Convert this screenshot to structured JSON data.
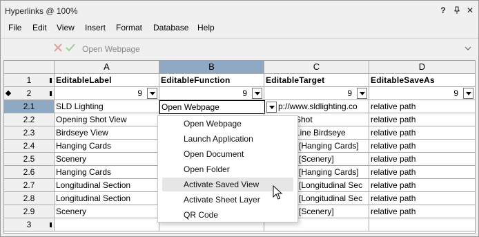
{
  "window": {
    "title": "Hyperlinks @ 100%"
  },
  "titlebar_buttons": [
    "?",
    "▾",
    "✕"
  ],
  "menu": [
    "File",
    "Edit",
    "View",
    "Insert",
    "Format",
    "Database",
    "Help"
  ],
  "command_bar": {
    "value": "Open Webpage"
  },
  "grid": {
    "columns": [
      "A",
      "B",
      "C",
      "D"
    ],
    "header_row": {
      "label": "1",
      "fields": [
        "EditableLabel",
        "EditableFunction",
        "EditableTarget",
        "EditableSaveAs"
      ]
    },
    "width_row": {
      "label": "2",
      "values": [
        "9",
        "9",
        "9",
        "9"
      ]
    },
    "rows": [
      {
        "label": "2.1",
        "cells": [
          "SLD Lighting",
          "Open Webpage",
          "p://www.sldlighting.co",
          "relative path"
        ]
      },
      {
        "label": "2.2",
        "cells": [
          "Opening Shot View",
          "",
          "Shot",
          "relative path"
        ]
      },
      {
        "label": "2.3",
        "cells": [
          "Birdseye View",
          "",
          "Line Birdseye",
          "relative path"
        ]
      },
      {
        "label": "2.4",
        "cells": [
          "Hanging Cards",
          "",
          "[Hanging Cards]",
          "relative path"
        ]
      },
      {
        "label": "2.5",
        "cells": [
          "Scenery",
          "",
          "[Scenery]",
          "relative path"
        ]
      },
      {
        "label": "2.6",
        "cells": [
          "Hanging Cards",
          "",
          "[Hanging Cards]",
          "relative path"
        ]
      },
      {
        "label": "2.7",
        "cells": [
          "Longitudinal Section",
          "",
          "[Longitudinal Sec",
          "relative path"
        ]
      },
      {
        "label": "2.8",
        "cells": [
          "Longitudinal Section",
          "",
          "[Longitudinal Sec",
          "relative path"
        ]
      },
      {
        "label": "2.9",
        "cells": [
          "Scenery",
          "",
          "[Scenery]",
          "relative path"
        ]
      }
    ],
    "last_row": {
      "label": "3"
    }
  },
  "dropdown": {
    "items": [
      "Open Webpage",
      "Launch Application",
      "Open Document",
      "Open Folder",
      "Activate Saved View",
      "Activate Sheet Layer",
      "QR Code"
    ],
    "hovered": "Activate Saved View"
  }
}
